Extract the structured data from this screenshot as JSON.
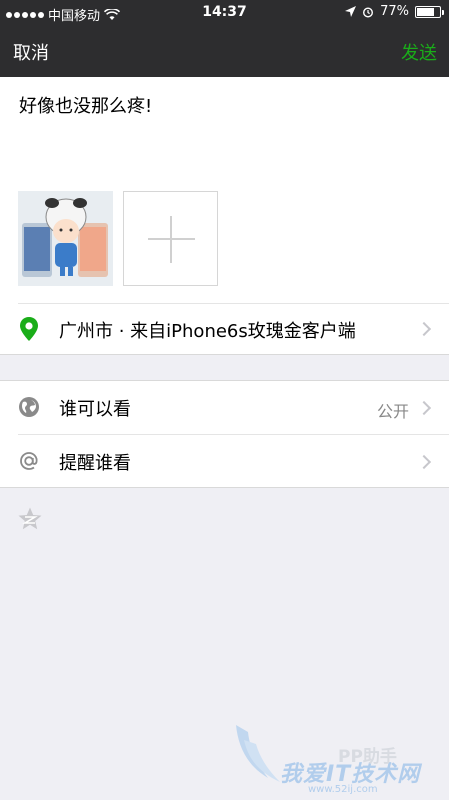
{
  "status_bar": {
    "carrier": "中国移动",
    "time": "14:37",
    "battery": "77%",
    "battery_level": 0.77
  },
  "nav": {
    "cancel_label": "取消",
    "send_label": "发送"
  },
  "compose": {
    "text": "好像也没那么疼!",
    "photos": [
      {
        "icon": "photo-thumbnail"
      }
    ],
    "add_photo_icon": "plus-icon",
    "location": {
      "icon": "location-pin-icon",
      "text": "广州市 · 来自iPhone6s玫瑰金客户端"
    }
  },
  "settings": {
    "visibility": {
      "icon": "globe-icon",
      "label": "谁可以看",
      "value": "公开"
    },
    "mention": {
      "icon": "at-icon",
      "label": "提醒谁看"
    }
  },
  "extra_icon": "star-icon",
  "watermark": {
    "main": "我爱IT技术网",
    "brand": "PP助手",
    "url": "www.52ij.com"
  },
  "colors": {
    "bar": "#2d2d2f",
    "send": "#1aad19",
    "location_pin": "#1aad19",
    "background": "#efeff4"
  }
}
